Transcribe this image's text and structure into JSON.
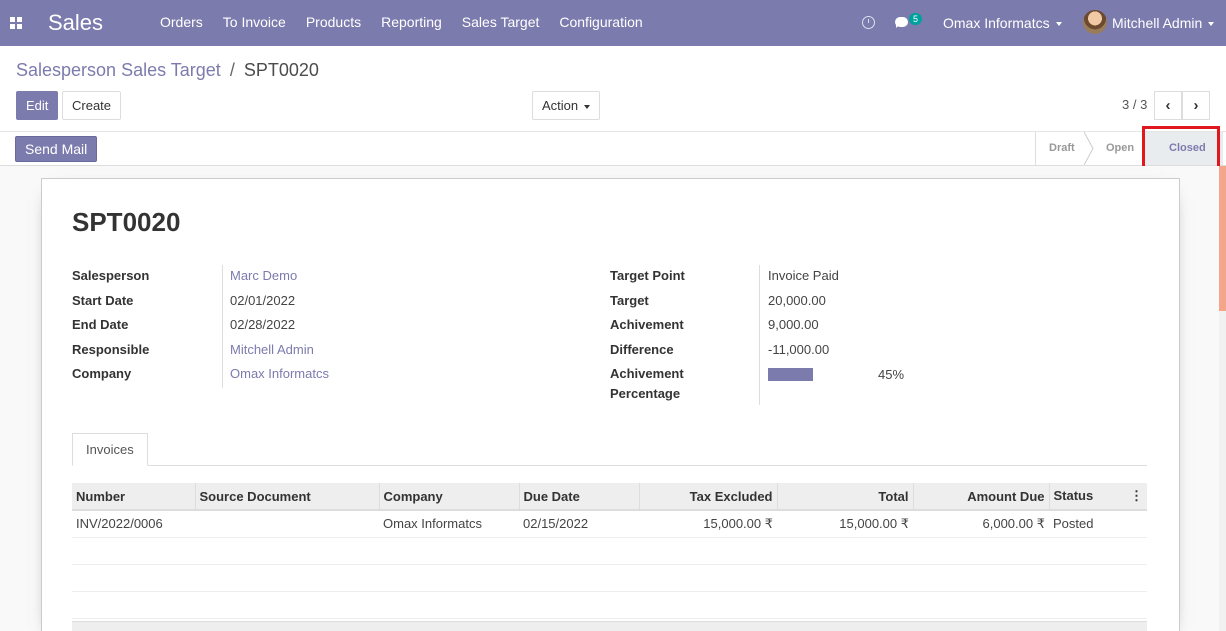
{
  "navbar": {
    "app_name": "Sales",
    "menu": [
      "Orders",
      "To Invoice",
      "Products",
      "Reporting",
      "Sales Target",
      "Configuration"
    ],
    "chat_badge": "5",
    "company": "Omax Informatcs",
    "user": "Mitchell Admin"
  },
  "breadcrumb": {
    "parent": "Salesperson Sales Target",
    "separator": "/",
    "current": "SPT0020"
  },
  "toolbar": {
    "edit_label": "Edit",
    "create_label": "Create",
    "action_label": "Action",
    "pager": "3 / 3"
  },
  "statusbar": {
    "send_mail_label": "Send Mail",
    "stages": [
      "Draft",
      "Open",
      "Closed"
    ],
    "active_stage": "Closed"
  },
  "form": {
    "name": "SPT0020",
    "left": [
      {
        "label": "Salesperson",
        "value": "Marc Demo",
        "link": true
      },
      {
        "label": "Start Date",
        "value": "02/01/2022",
        "link": false
      },
      {
        "label": "End Date",
        "value": "02/28/2022",
        "link": false
      },
      {
        "label": "Responsible",
        "value": "Mitchell Admin",
        "link": true
      },
      {
        "label": "Company",
        "value": "Omax Informatcs",
        "link": true
      }
    ],
    "right": [
      {
        "label": "Target Point",
        "value": "Invoice Paid"
      },
      {
        "label": "Target",
        "value": "20,000.00"
      },
      {
        "label": "Achivement",
        "value": "9,000.00"
      },
      {
        "label": "Difference",
        "value": "-11,000.00"
      }
    ],
    "percentage_label_1": "Achivement",
    "percentage_label_2": "Percentage",
    "percentage_value": 45,
    "percentage_text": "45%"
  },
  "notebook": {
    "tab_label": "Invoices",
    "columns": [
      "Number",
      "Source Document",
      "Company",
      "Due Date",
      "Tax Excluded",
      "Total",
      "Amount Due",
      "Status"
    ],
    "rows": [
      {
        "number": "INV/2022/0006",
        "source": "",
        "company": "Omax Informatcs",
        "due_date": "02/15/2022",
        "tax_excluded": "15,000.00 ₹",
        "total": "15,000.00 ₹",
        "amount_due": "6,000.00 ₹",
        "status": "Posted"
      }
    ]
  },
  "colors": {
    "primary": "#7c7bad",
    "highlight": "#e1171e"
  }
}
